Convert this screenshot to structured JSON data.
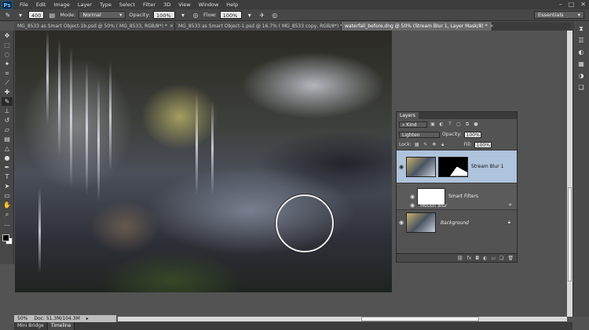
{
  "menu": {
    "logo": "Ps",
    "items": [
      "File",
      "Edit",
      "Image",
      "Layer",
      "Type",
      "Select",
      "Filter",
      "3D",
      "View",
      "Window",
      "Help"
    ],
    "window_controls": [
      "–",
      "□",
      "✕"
    ]
  },
  "options": {
    "brush_size": "400",
    "mode_label": "Mode:",
    "mode_value": "Normal",
    "opacity_label": "Opacity:",
    "opacity_value": "100%",
    "flow_label": "Flow:",
    "flow_value": "100%",
    "workspace": "Essentials"
  },
  "tabs": [
    {
      "label": "MG_8533 as Smart Object-1b.psd @ 50% ( MG_8533, RGB/8*) *",
      "active": false
    },
    {
      "label": "MG_8533 as Smart Object-1.psd @ 16.7% ( MG_8533 copy, RGB/8*) *",
      "active": false
    },
    {
      "label": "waterfall_before.dng @ 50% (Stream Blur 1, Layer Mask/8) *",
      "active": true
    }
  ],
  "layers_panel": {
    "title": "Layers",
    "filter_kind": "Kind",
    "blend_mode": "Lighten",
    "opacity_label": "Opacity:",
    "opacity_value": "100%",
    "lock_label": "Lock:",
    "fill_label": "Fill:",
    "fill_value": "100%",
    "layers": [
      {
        "name": "Stream Blur 1",
        "selected": true
      },
      {
        "name": "Smart Filters",
        "sub_filter": "Motion Blur"
      },
      {
        "name": "Background",
        "locked": true
      }
    ]
  },
  "status": {
    "zoom": "50%",
    "doc": "Doc: 51.3M/104.3M"
  },
  "bottom_tabs": [
    "Mini Bridge",
    "Timeline"
  ]
}
